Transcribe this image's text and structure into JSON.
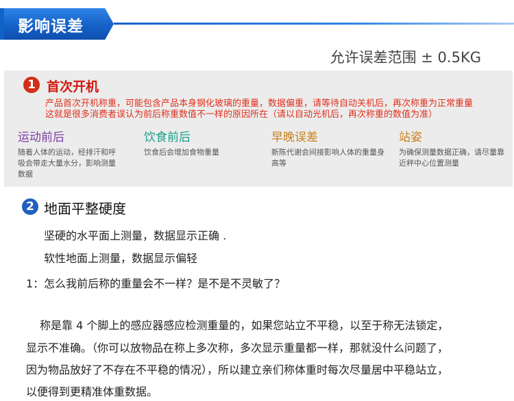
{
  "header": {
    "title": "影响误差"
  },
  "tolerance": "允许误差范围 ± 0.5KG",
  "section1": {
    "number": "1",
    "title": "首次开机",
    "desc_lines": [
      "产品首次开机称重，可能包含产品本身钢化玻璃的重量，数据偏重，请等待自动关机后，再次称重为正常重量",
      "这就是很多消费者误认为前后称重数值不一样的原因所在（请以自动光机后，再次称重的数值为准）"
    ],
    "factors": [
      {
        "title": "运动前后",
        "color": "#7b3fa0",
        "desc": "随着人体的运动，经排汗和呼吸会带走大量水分，影响测量数据"
      },
      {
        "title": "饮食前后",
        "color": "#1c9f8a",
        "desc": "饮食后会增加食物重量"
      },
      {
        "title": "早晚误差",
        "color": "#c9801b",
        "desc": "新陈代谢会间接影响人体的重量身高等"
      },
      {
        "title": "站姿",
        "color": "#c9801b",
        "desc": "为确保测量数据正确，请尽量靠近秤中心位置测量"
      }
    ]
  },
  "section2": {
    "number": "2",
    "title": "地面平整硬度",
    "line1": "坚硬的水平面上测量，数据显示正确 .",
    "line2": "软性地面上测量，数据显示偏轻",
    "question": "1：怎么我前后称的重量会不一样？是不是不灵敏了？",
    "answer_lines": [
      "称是靠 4 个脚上的感应器感应检测重量的，如果您站立不平稳，以至于称无法锁定，",
      "显示不准确。（你可以放物品在称上多次称，多次显示重量都一样，那就没什么问题了，",
      "因为物品放好了不存在不平稳的情况），所以建立亲们称体重时每次尽量居中平稳站立，",
      "以便得到更精准体重数据。"
    ]
  }
}
